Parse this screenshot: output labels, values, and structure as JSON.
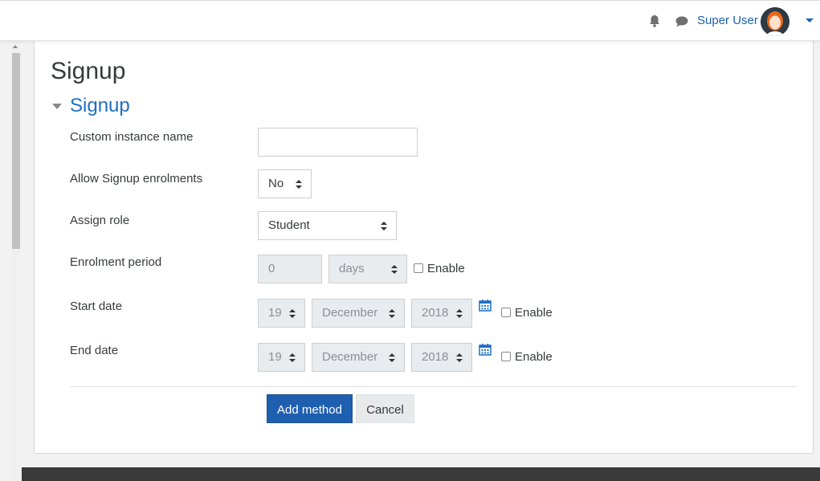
{
  "header": {
    "user_name": "Super User",
    "icons": [
      "bell-icon",
      "chat-icon",
      "avatar",
      "chevron-down-icon"
    ]
  },
  "page": {
    "title": "Signup",
    "section_title": "Signup"
  },
  "form": {
    "instance_name": {
      "label": "Custom instance name",
      "value": ""
    },
    "allow_enrol": {
      "label": "Allow Signup enrolments",
      "value": "No"
    },
    "assign_role": {
      "label": "Assign role",
      "value": "Student"
    },
    "enrol_period": {
      "label": "Enrolment period",
      "value": "0",
      "unit": "days",
      "enable_label": "Enable"
    },
    "start_date": {
      "label": "Start date",
      "day": "19",
      "month": "December",
      "year": "2018",
      "enable_label": "Enable"
    },
    "end_date": {
      "label": "End date",
      "day": "19",
      "month": "December",
      "year": "2018",
      "enable_label": "Enable"
    }
  },
  "buttons": {
    "add": "Add method",
    "cancel": "Cancel"
  },
  "colors": {
    "accent": "#1f5fb0",
    "section_title": "#1f6fc5",
    "footer": "#3a3a3a"
  }
}
